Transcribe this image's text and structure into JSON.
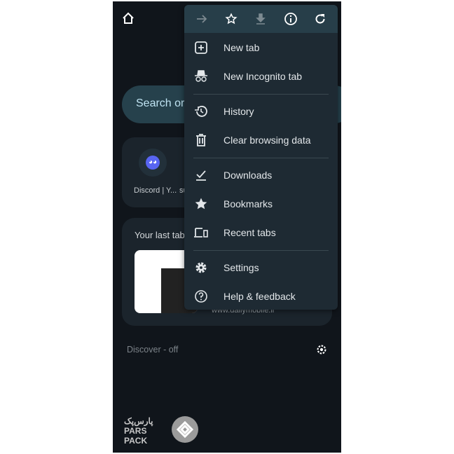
{
  "search": {
    "placeholder": "Search or"
  },
  "tiles": [
    {
      "label": "Discord | Y..."
    },
    {
      "label": "su"
    }
  ],
  "last_tab": {
    "title": "Your last tab",
    "url": "www.dailymobile.ir"
  },
  "discover": {
    "label": "Discover - off"
  },
  "toolbar": {
    "icons": [
      "forward-arrow-icon",
      "star-outline-icon",
      "download-icon",
      "info-icon",
      "refresh-icon"
    ]
  },
  "menu": {
    "items": [
      {
        "label": "New tab",
        "icon": "new-tab-icon"
      },
      {
        "label": "New Incognito tab",
        "icon": "incognito-icon"
      },
      {
        "label": "History",
        "icon": "history-icon"
      },
      {
        "label": "Clear browsing data",
        "icon": "trash-icon"
      },
      {
        "label": "Downloads",
        "icon": "downloads-icon"
      },
      {
        "label": "Bookmarks",
        "icon": "star-icon"
      },
      {
        "label": "Recent tabs",
        "icon": "devices-icon"
      },
      {
        "label": "Settings",
        "icon": "gear-icon"
      },
      {
        "label": "Help & feedback",
        "icon": "help-icon"
      }
    ]
  },
  "watermark": {
    "text": "PARS PACK"
  },
  "colors": {
    "background": "#10151b",
    "menu": "#1e2a33",
    "menu_toolbar": "#273e49",
    "search": "#26414c",
    "discord": "#5865f2"
  }
}
